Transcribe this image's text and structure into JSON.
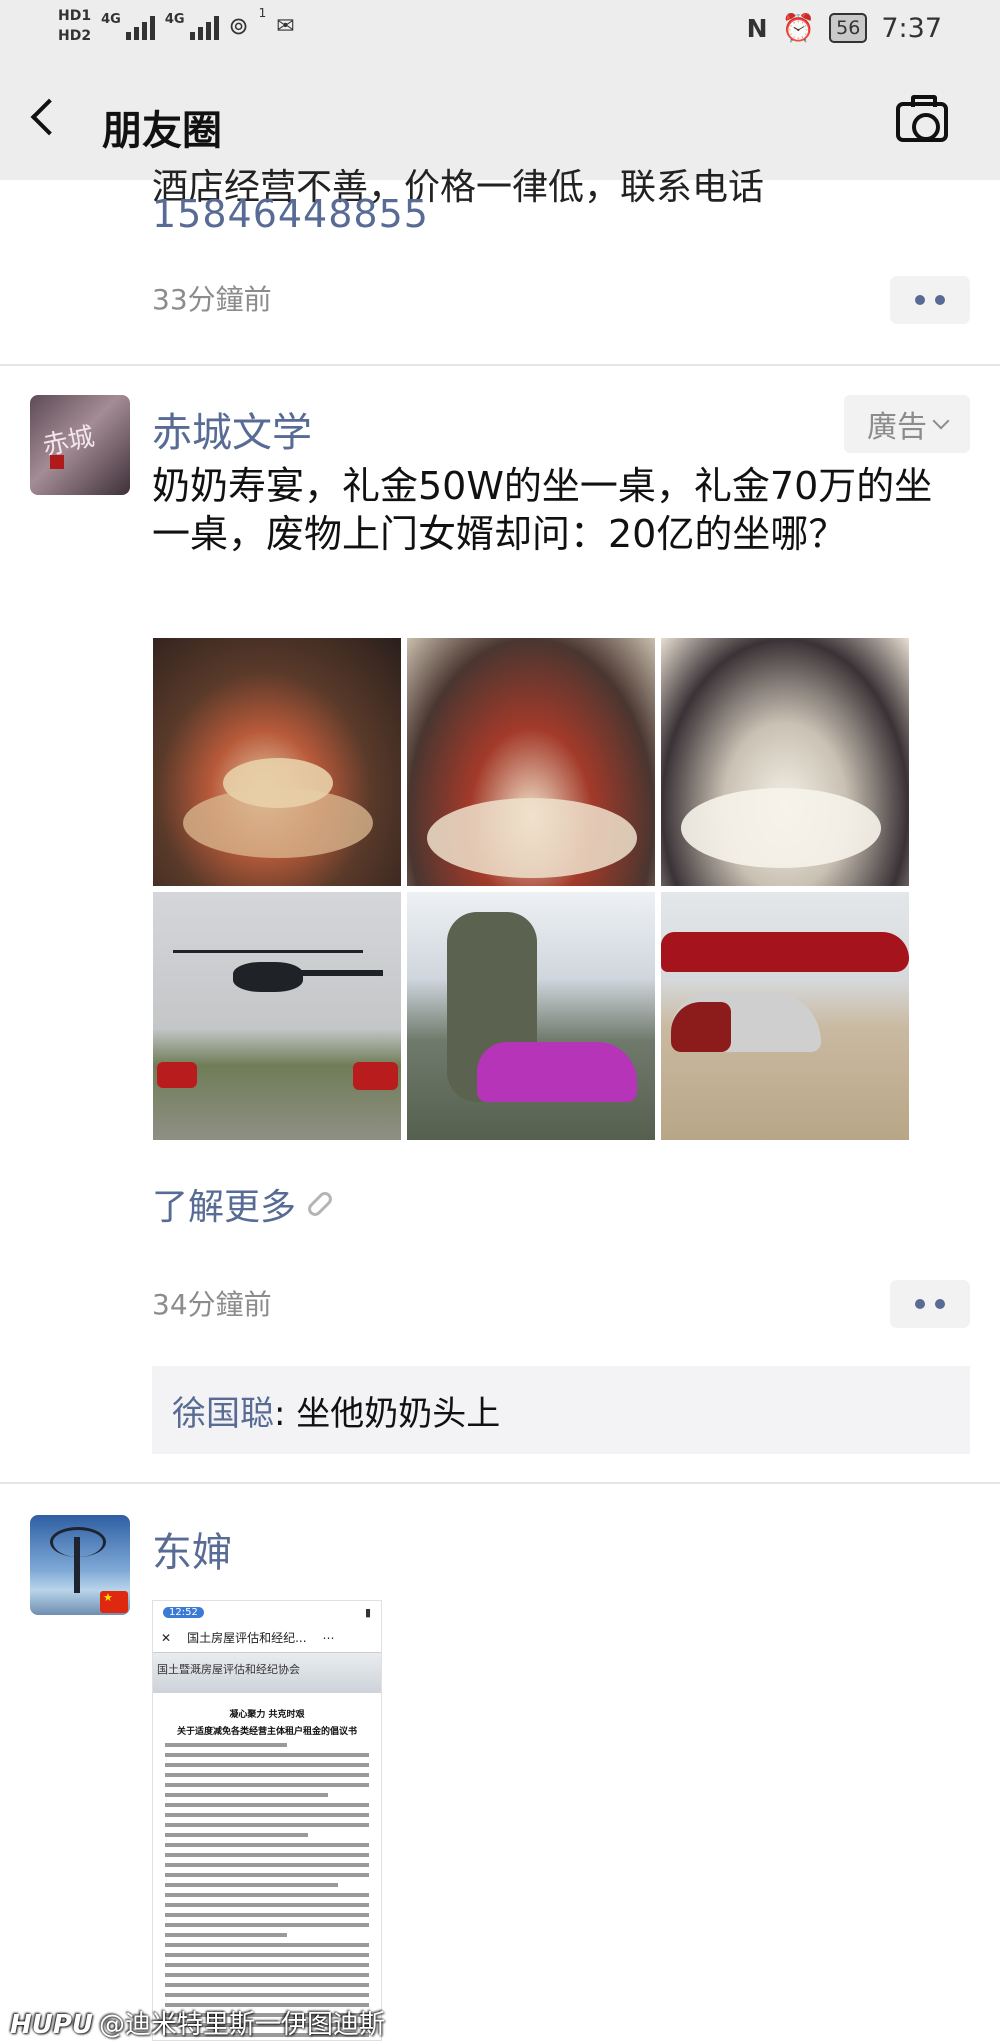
{
  "status_bar": {
    "hd1": "HD1",
    "hd2": "HD2",
    "signal1": "4G",
    "signal2": "4G",
    "hotspot_count": "1",
    "battery": "56",
    "time": "7:37"
  },
  "header": {
    "title": "朋友圈"
  },
  "feed": {
    "post0": {
      "partial_text": "酒店经营不善，价格一律低，联系电话",
      "phone": "15846448855",
      "time": "33分鐘前"
    },
    "post1": {
      "nickname": "赤城文学",
      "avatar_text": "赤城",
      "ad_tag": "廣告",
      "text": "奶奶寿宴，礼金50W的坐一桌，礼金70万的坐一桌，废物上门女婿却问：20亿的坐哪？",
      "learn_more": "了解更多",
      "time": "34分鐘前",
      "comment": {
        "author": "徐国聪",
        "text": ": 坐他奶奶头上"
      }
    },
    "post2": {
      "nickname": "东婶",
      "doc": {
        "time": "12:52",
        "title": "国土房屋评估和经纪...",
        "banner": "国土暨溉房屋评估和经纪协会",
        "heading1": "凝心聚力 共克时艰",
        "heading2": "关于适度减免各类经营主体租户租金的倡议书"
      }
    }
  },
  "watermark": {
    "logo": "HUPU",
    "text": "@迪米特里斯一伊图迪斯"
  },
  "colors": {
    "link": "#576b95",
    "header_bg": "#ededed",
    "meta": "#8c8c8c"
  }
}
